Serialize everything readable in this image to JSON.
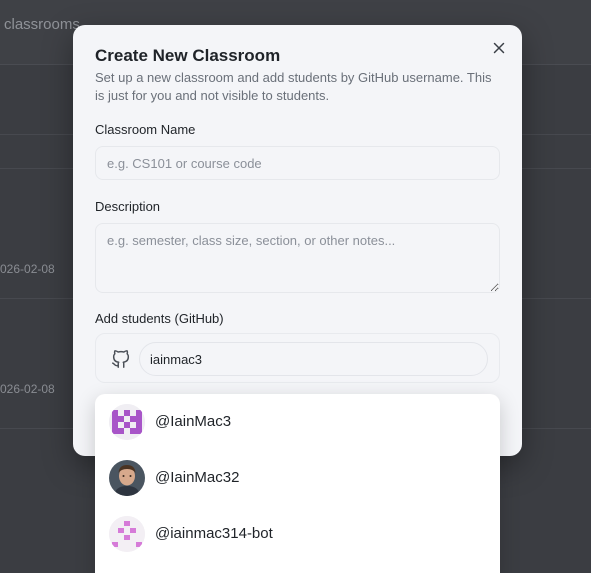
{
  "background": {
    "title": "classrooms",
    "dates": [
      "026-02-08",
      "026-02-08"
    ]
  },
  "modal": {
    "title": "Create New Classroom",
    "subtitle": "Set up a new classroom and add students by GitHub username. This is just for you and not visible to students.",
    "name_label": "Classroom Name",
    "name_placeholder": "e.g. CS101 or course code",
    "description_label": "Description",
    "description_placeholder": "e.g. semester, class size, section, or other notes...",
    "students_label": "Add students (GitHub)",
    "students_value": "iainmac3"
  },
  "dropdown": {
    "items": [
      {
        "username": "@IainMac3",
        "avatar": "pixel-identicon-purple"
      },
      {
        "username": "@IainMac32",
        "avatar": "photo-portrait"
      },
      {
        "username": "@iainmac314-bot",
        "avatar": "pixel-identicon-pink"
      }
    ]
  },
  "colors": {
    "accent_purple": "#a855c8",
    "accent_pink": "#d67bd8"
  }
}
